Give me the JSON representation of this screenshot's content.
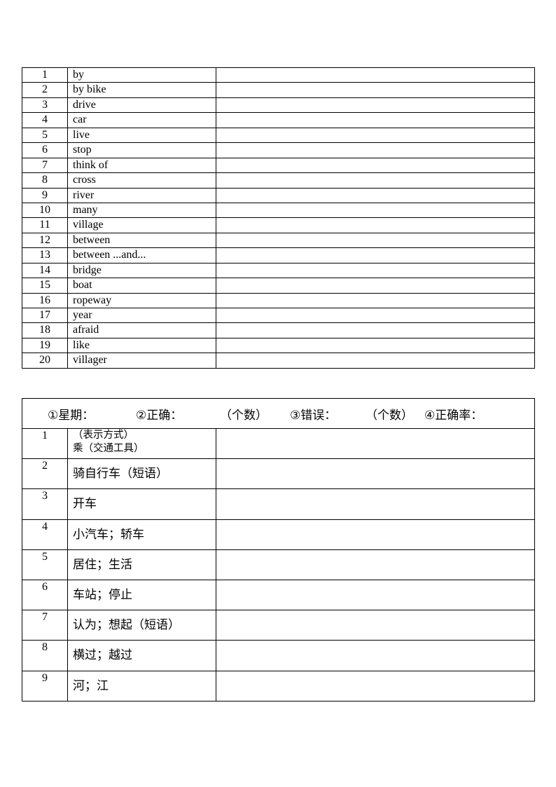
{
  "vocab_table": {
    "rows": [
      {
        "num": "1",
        "word": "by"
      },
      {
        "num": "2",
        "word": "by bike"
      },
      {
        "num": "3",
        "word": "drive"
      },
      {
        "num": "4",
        "word": "car"
      },
      {
        "num": "5",
        "word": "live"
      },
      {
        "num": "6",
        "word": "stop"
      },
      {
        "num": "7",
        "word": "think of"
      },
      {
        "num": "8",
        "word": "cross"
      },
      {
        "num": "9",
        "word": "river"
      },
      {
        "num": "10",
        "word": "many"
      },
      {
        "num": "11",
        "word": "village"
      },
      {
        "num": "12",
        "word": "between"
      },
      {
        "num": "13",
        "word": "between ...and..."
      },
      {
        "num": "14",
        "word": "bridge"
      },
      {
        "num": "15",
        "word": "boat"
      },
      {
        "num": "16",
        "word": "ropeway"
      },
      {
        "num": "17",
        "word": "year"
      },
      {
        "num": "18",
        "word": "afraid"
      },
      {
        "num": "19",
        "word": "like"
      },
      {
        "num": "20",
        "word": "villager"
      }
    ]
  },
  "quiz_table": {
    "header": {
      "weekday": "①星期：",
      "correct": "②正确：",
      "correct_unit": "（个数）",
      "wrong": "③错误：",
      "wrong_unit": "（个数）",
      "accuracy": "④正确率："
    },
    "rows": [
      {
        "num": "1",
        "lines": [
          "（表示方式）",
          "乘（交通工具）"
        ]
      },
      {
        "num": "2",
        "meaning": "骑自行车（短语）"
      },
      {
        "num": "3",
        "meaning": "开车"
      },
      {
        "num": "4",
        "meaning": "小汽车；轿车"
      },
      {
        "num": "5",
        "meaning": "居住；生活"
      },
      {
        "num": "6",
        "meaning": "车站；停止"
      },
      {
        "num": "7",
        "meaning": "认为；想起（短语）"
      },
      {
        "num": "8",
        "meaning": "横过；越过"
      },
      {
        "num": "9",
        "meaning": "河；江"
      }
    ]
  }
}
